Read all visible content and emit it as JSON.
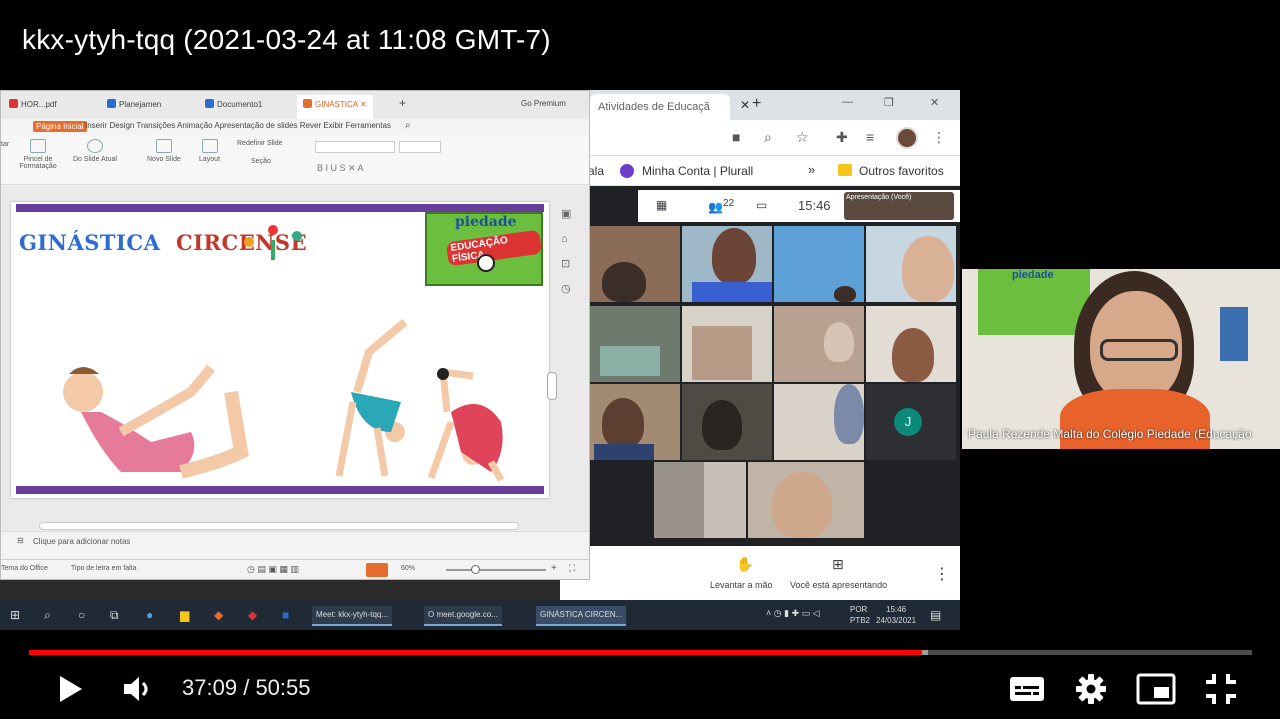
{
  "video": {
    "title": "kkx-ytyh-tqq (2021-03-24 at 11:08 GMT-7)",
    "current_time": "37:09",
    "separator": "/",
    "duration": "50:55",
    "progress_fraction": 0.73,
    "buffered_fraction": 0.735
  },
  "chrome": {
    "tab_title": "Atividades de Educaçã",
    "bookmarks": [
      "ala",
      "Minha Conta | Plurall",
      "Outros favoritos"
    ],
    "bookmark_more": "»"
  },
  "meet": {
    "participants_count": "22",
    "clock": "15:46",
    "presentation_thumb_label": "Apresentação (Você)",
    "avatar_letter": "J",
    "raise_hand_label": "Levantar a mão",
    "presenting_label": "Você está apresentando",
    "more": "⋮"
  },
  "wps": {
    "tabs": [
      "HOR...pdf",
      "Planejamen",
      "Documento1",
      "GINÁSTICA",
      "Go Premium"
    ],
    "menu_home": "Página Inicial",
    "menu_items": "Inserir Design Transições Animação Apresentação de slides Rever Exibir Ferramentas",
    "ribbon": {
      "paste": "tar",
      "format_painter": "Pincel de Formatação",
      "from_current": "Do Slide Atual",
      "new_slide": "Novo Slide",
      "layout": "Layout",
      "reset": "Redefinir Slide",
      "section": "Seção"
    },
    "slide": {
      "title_part1": "GINÁSTICA",
      "title_part2": "CIRCENSE",
      "logo_word": "piedade",
      "logo_arc": "EDUCAÇÃO FÍSICA"
    },
    "notes_placeholder": "Clique para adicionar notas",
    "status_left": "Tema do Office",
    "status_font": "Tipo de letra em falta",
    "zoom": "60%"
  },
  "taskbar": {
    "items": [
      "Meet: kkx-ytyh-tqq...",
      "O meet.google.co...",
      "GINÁSTICA CIRCEN..."
    ],
    "lang": "POR",
    "lang2": "PTB2",
    "time": "15:46",
    "date": "24/03/2021"
  },
  "presenter": {
    "name": "Paula Rezende Malta do Colégio Piedade (Educação",
    "banner_word": "piedade"
  },
  "colors": {
    "progress": "#ff0000",
    "slide_bar": "#6a3d9a",
    "wps_accent": "#e46c2c",
    "meet_bg": "#202124"
  }
}
